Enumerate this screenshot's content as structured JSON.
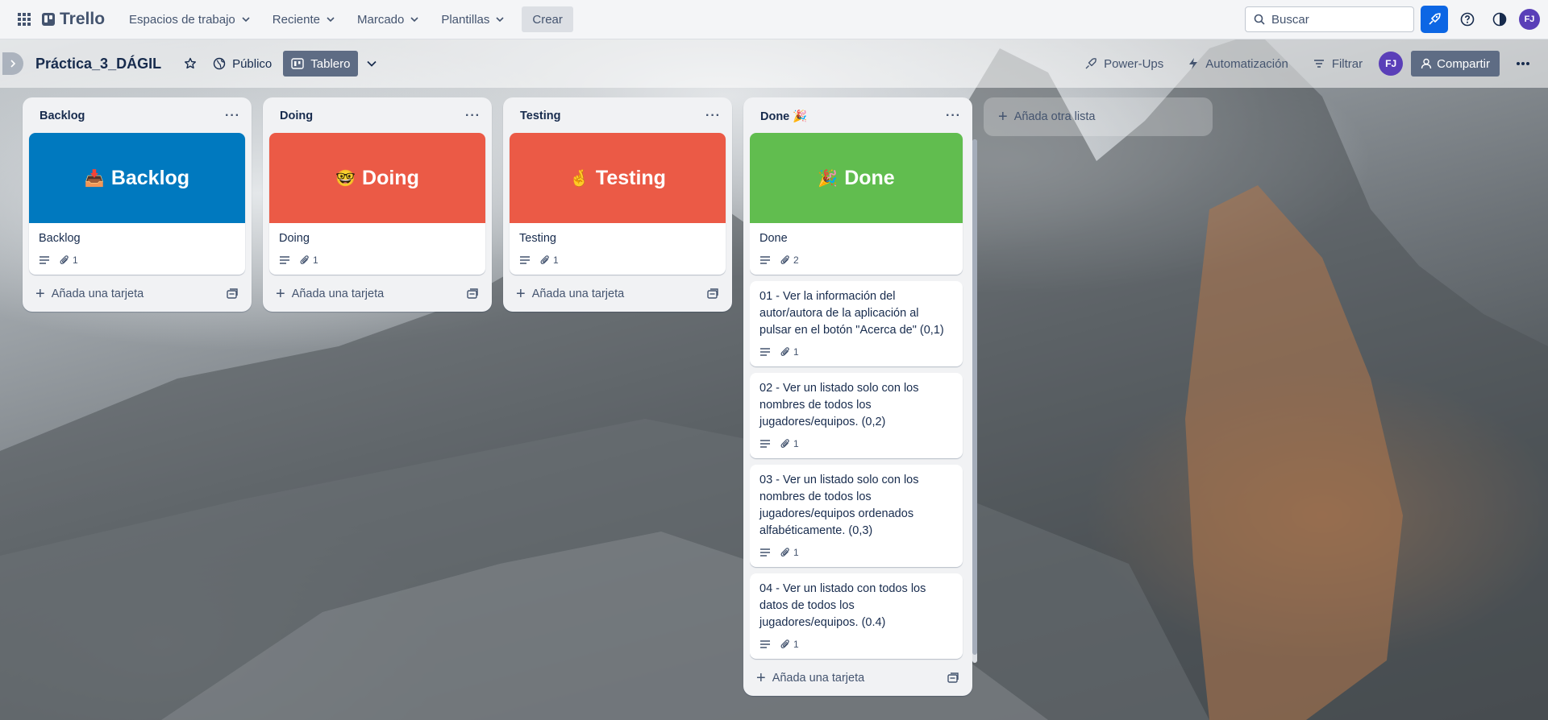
{
  "nav": {
    "brand": "Trello",
    "items": [
      "Espacios de trabajo",
      "Reciente",
      "Marcado",
      "Plantillas"
    ],
    "create_label": "Crear",
    "search_placeholder": "Buscar",
    "avatar_initials": "FJ"
  },
  "board": {
    "title": "Práctica_3_DÁGIL",
    "visibility": "Público",
    "view": "Tablero",
    "powerups": "Power-Ups",
    "automation": "Automatización",
    "filter": "Filtrar",
    "share": "Compartir",
    "avatar_initials": "FJ"
  },
  "lists": [
    {
      "title": "Backlog",
      "cards": [
        {
          "cover_color": "#0079bf",
          "cover_emoji": "📥",
          "cover_text": "Backlog",
          "title": "Backlog",
          "attachments": "1"
        }
      ],
      "add_card": "Añada una tarjeta"
    },
    {
      "title": "Doing",
      "cards": [
        {
          "cover_color": "#eb5a46",
          "cover_emoji": "🤓",
          "cover_text": "Doing",
          "title": "Doing",
          "attachments": "1"
        }
      ],
      "add_card": "Añada una tarjeta"
    },
    {
      "title": "Testing",
      "cards": [
        {
          "cover_color": "#eb5a46",
          "cover_emoji": "🤞",
          "cover_text": "Testing",
          "title": "Testing",
          "attachments": "1"
        }
      ],
      "add_card": "Añada una tarjeta"
    },
    {
      "title": "Done 🎉",
      "cards": [
        {
          "cover_color": "#61bd4f",
          "cover_emoji": "🎉",
          "cover_text": "Done",
          "title": "Done",
          "attachments": "2"
        },
        {
          "title": "01 - Ver la información del autor/autora de la aplicación al pulsar en el botón \"Acerca de\" (0,1)",
          "attachments": "1"
        },
        {
          "title": "02 - Ver un listado solo con los nombres de todos los jugadores/equipos. (0,2)",
          "attachments": "1"
        },
        {
          "title": "03 - Ver un listado solo con los nombres de todos los jugadores/equipos ordenados alfabéticamente. (0,3)",
          "attachments": "1"
        },
        {
          "title": "04 - Ver un listado con todos los datos de todos los jugadores/equipos. (0.4)",
          "attachments": "1"
        }
      ],
      "add_card": "Añada una tarjeta"
    }
  ],
  "add_list": "Añada otra lista"
}
